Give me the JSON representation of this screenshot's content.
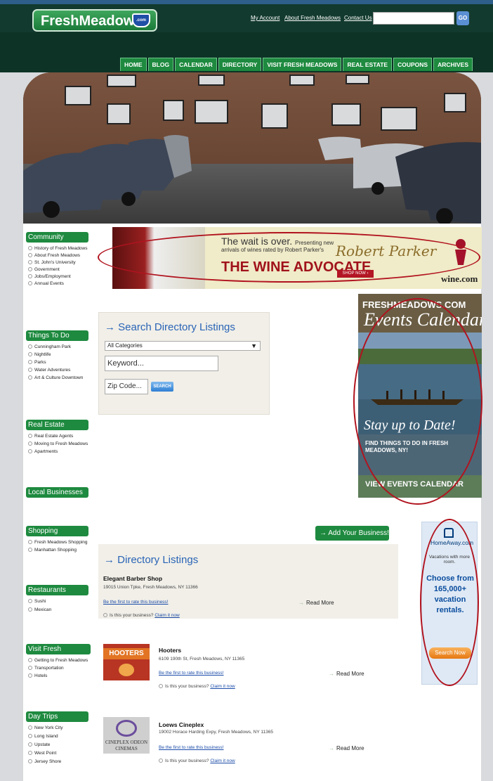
{
  "header": {
    "logo_text": "FreshMeadows",
    "logo_badge": ".com",
    "links": [
      "My Account",
      "About Fresh Meadows",
      "Contact Us"
    ],
    "search_value": "",
    "search_button": "GO"
  },
  "nav": [
    "HOME",
    "BLOG",
    "CALENDAR",
    "DIRECTORY",
    "VISIT FRESH MEADOWS",
    "REAL ESTATE",
    "COUPONS",
    "ARCHIVES"
  ],
  "sidebar": {
    "community": {
      "title": "Community",
      "items": [
        "History of Fresh Meadows",
        "About Fresh Meadows",
        "St. John's University",
        "Government",
        "Jobs/Employment",
        "Annual Events"
      ]
    },
    "things_to_do": {
      "title": "Things To Do",
      "items": [
        "Cunningham Park",
        "Nightlife",
        "Parks",
        "Water Adventures",
        "Art & Culture Downtown"
      ]
    },
    "real_estate": {
      "title": "Real Estate",
      "items": [
        "Real Estate Agents",
        "Moving to Fresh Meadows",
        "Apartments"
      ]
    },
    "local_businesses": {
      "title": "Local Businesses",
      "items": []
    },
    "shopping": {
      "title": "Shopping",
      "items": [
        "Fresh Meadows Shopping",
        "Manhattan Shopping"
      ]
    },
    "restaurants": {
      "title": "Restaurants",
      "items": [
        "Sushi",
        "Mexican"
      ]
    },
    "visit": {
      "title": "Visit Fresh Meadows",
      "items": [
        "Getting to Fresh Meadows",
        "Transportation",
        "Hotels"
      ]
    },
    "day_trips": {
      "title": "Day Trips",
      "items": [
        "New York City",
        "Long Island",
        "Upstate",
        "West Point",
        "Jersey Shore"
      ]
    }
  },
  "wine_ad": {
    "line1": "The wait is over.",
    "line1b": "Presenting new",
    "line2": "arrivals of wines rated by Robert Parker's",
    "title": "THE WINE ADVOCATE",
    "shop": "SHOP NOW ›",
    "signature": "Robert Parker",
    "brand": "wine.com"
  },
  "calendar_ad": {
    "brand": "FRESHMEADOWS.COM",
    "title": "Events Calendar",
    "stay": "Stay up to Date!",
    "find": "FIND THINGS TO DO IN FRESH MEADOWS, NY!",
    "view": "VIEW EVENTS CALENDAR"
  },
  "search_directory": {
    "title": "→ Search Directory Listings",
    "category": "All Categories",
    "keyword_placeholder": "Keyword...",
    "zip_placeholder": "Zip Code...",
    "button": "SEARCH"
  },
  "add_business": "→ Add Your Business!",
  "homeaway": {
    "logo": "HomeAway.com",
    "sub": "Vacations with more room.",
    "main": "Choose from 165,000+ vacation rentals.",
    "button": "Search Now"
  },
  "directory": {
    "title": "→ Directory Listings",
    "rate_text": "Be the first to rate this business!",
    "claim_prefix": "Is this your business?",
    "claim_link": "Claim it now",
    "read_more": "Read More",
    "listings": [
      {
        "name": "Elegant Barber Shop",
        "address": "19015 Union Tpke, Fresh Meadows, NY 11366",
        "thumb": ""
      },
      {
        "name": "Hooters",
        "address": "6109 190th St, Fresh Meadows, NY 11365",
        "thumb": "HOOTERS"
      },
      {
        "name": "Loews Cineplex",
        "address": "19002 Horace Harding Expy, Fresh Meadows, NY 11365",
        "thumb": "CINEPLEX ODEON CINEMAS"
      }
    ]
  },
  "colors": {
    "nav_green": "#1e8a3f",
    "header_dark": "#123a2e",
    "link_blue": "#2a64b6",
    "annotation_red": "#b1131e"
  }
}
